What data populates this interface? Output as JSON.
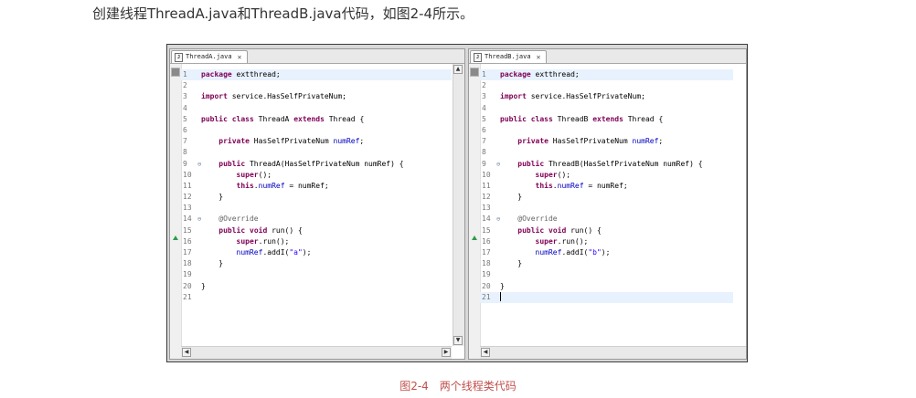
{
  "intro_text": "创建线程ThreadA.java和ThreadB.java代码，如图2-4所示。",
  "caption": "图2-4　两个线程类代码",
  "editors": [
    {
      "tab_label": "ThreadA.java",
      "lines": [
        {
          "n": "1",
          "code": [
            {
              "t": "package",
              "c": "kw"
            },
            {
              "t": " extthread;"
            }
          ]
        },
        {
          "n": "2",
          "code": []
        },
        {
          "n": "3",
          "code": [
            {
              "t": "import",
              "c": "kw"
            },
            {
              "t": " service.HasSelfPrivateNum;"
            }
          ]
        },
        {
          "n": "4",
          "code": []
        },
        {
          "n": "5",
          "code": [
            {
              "t": "public",
              "c": "kw"
            },
            {
              "t": " "
            },
            {
              "t": "class",
              "c": "kw"
            },
            {
              "t": " ThreadA "
            },
            {
              "t": "extends",
              "c": "kw"
            },
            {
              "t": " Thread {"
            }
          ]
        },
        {
          "n": "6",
          "code": []
        },
        {
          "n": "7",
          "code": [
            {
              "t": "    "
            },
            {
              "t": "private",
              "c": "kw"
            },
            {
              "t": " HasSelfPrivateNum "
            },
            {
              "t": "numRef",
              "c": "fld"
            },
            {
              "t": ";"
            }
          ]
        },
        {
          "n": "8",
          "code": []
        },
        {
          "n": "9",
          "fold": "⊖",
          "code": [
            {
              "t": "    "
            },
            {
              "t": "public",
              "c": "kw"
            },
            {
              "t": " ThreadA(HasSelfPrivateNum numRef) {"
            }
          ]
        },
        {
          "n": "10",
          "code": [
            {
              "t": "        "
            },
            {
              "t": "super",
              "c": "kw"
            },
            {
              "t": "();"
            }
          ]
        },
        {
          "n": "11",
          "code": [
            {
              "t": "        "
            },
            {
              "t": "this",
              "c": "kw"
            },
            {
              "t": "."
            },
            {
              "t": "numRef",
              "c": "fld"
            },
            {
              "t": " = numRef;"
            }
          ]
        },
        {
          "n": "12",
          "code": [
            {
              "t": "    }"
            }
          ]
        },
        {
          "n": "13",
          "code": []
        },
        {
          "n": "14",
          "fold": "⊖",
          "code": [
            {
              "t": "    "
            },
            {
              "t": "@Override",
              "c": "ann"
            }
          ]
        },
        {
          "n": "15",
          "code": [
            {
              "t": "    "
            },
            {
              "t": "public",
              "c": "kw"
            },
            {
              "t": " "
            },
            {
              "t": "void",
              "c": "kw"
            },
            {
              "t": " run() {"
            }
          ]
        },
        {
          "n": "16",
          "code": [
            {
              "t": "        "
            },
            {
              "t": "super",
              "c": "kw"
            },
            {
              "t": ".run();"
            }
          ]
        },
        {
          "n": "17",
          "code": [
            {
              "t": "        "
            },
            {
              "t": "numRef",
              "c": "fld"
            },
            {
              "t": ".addI("
            },
            {
              "t": "\"a\"",
              "c": "str"
            },
            {
              "t": ");"
            }
          ]
        },
        {
          "n": "18",
          "code": [
            {
              "t": "    }"
            }
          ]
        },
        {
          "n": "19",
          "code": []
        },
        {
          "n": "20",
          "code": [
            {
              "t": "}"
            }
          ]
        },
        {
          "n": "21",
          "code": []
        }
      ]
    },
    {
      "tab_label": "ThreadB.java",
      "lines": [
        {
          "n": "1",
          "code": [
            {
              "t": "package",
              "c": "kw"
            },
            {
              "t": " extthread;"
            }
          ]
        },
        {
          "n": "2",
          "code": []
        },
        {
          "n": "3",
          "code": [
            {
              "t": "import",
              "c": "kw"
            },
            {
              "t": " service.HasSelfPrivateNum;"
            }
          ]
        },
        {
          "n": "4",
          "code": []
        },
        {
          "n": "5",
          "code": [
            {
              "t": "public",
              "c": "kw"
            },
            {
              "t": " "
            },
            {
              "t": "class",
              "c": "kw"
            },
            {
              "t": " ThreadB "
            },
            {
              "t": "extends",
              "c": "kw"
            },
            {
              "t": " Thread {"
            }
          ]
        },
        {
          "n": "6",
          "code": []
        },
        {
          "n": "7",
          "code": [
            {
              "t": "    "
            },
            {
              "t": "private",
              "c": "kw"
            },
            {
              "t": " HasSelfPrivateNum "
            },
            {
              "t": "numRef",
              "c": "fld"
            },
            {
              "t": ";"
            }
          ]
        },
        {
          "n": "8",
          "code": []
        },
        {
          "n": "9",
          "fold": "⊖",
          "code": [
            {
              "t": "    "
            },
            {
              "t": "public",
              "c": "kw"
            },
            {
              "t": " ThreadB(HasSelfPrivateNum numRef) {"
            }
          ]
        },
        {
          "n": "10",
          "code": [
            {
              "t": "        "
            },
            {
              "t": "super",
              "c": "kw"
            },
            {
              "t": "();"
            }
          ]
        },
        {
          "n": "11",
          "code": [
            {
              "t": "        "
            },
            {
              "t": "this",
              "c": "kw"
            },
            {
              "t": "."
            },
            {
              "t": "numRef",
              "c": "fld"
            },
            {
              "t": " = numRef;"
            }
          ]
        },
        {
          "n": "12",
          "code": [
            {
              "t": "    }"
            }
          ]
        },
        {
          "n": "13",
          "code": []
        },
        {
          "n": "14",
          "fold": "⊖",
          "code": [
            {
              "t": "    "
            },
            {
              "t": "@Override",
              "c": "ann"
            }
          ]
        },
        {
          "n": "15",
          "code": [
            {
              "t": "    "
            },
            {
              "t": "public",
              "c": "kw"
            },
            {
              "t": " "
            },
            {
              "t": "void",
              "c": "kw"
            },
            {
              "t": " run() {"
            }
          ]
        },
        {
          "n": "16",
          "code": [
            {
              "t": "        "
            },
            {
              "t": "super",
              "c": "kw"
            },
            {
              "t": ".run();"
            }
          ]
        },
        {
          "n": "17",
          "code": [
            {
              "t": "        "
            },
            {
              "t": "numRef",
              "c": "fld"
            },
            {
              "t": ".addI("
            },
            {
              "t": "\"b\"",
              "c": "str"
            },
            {
              "t": ");"
            }
          ]
        },
        {
          "n": "18",
          "code": [
            {
              "t": "    }"
            }
          ]
        },
        {
          "n": "19",
          "code": []
        },
        {
          "n": "20",
          "code": [
            {
              "t": "}"
            }
          ]
        },
        {
          "n": "21",
          "code": [],
          "cursor": true
        }
      ]
    }
  ],
  "colors": {
    "keyword": "#7f0055",
    "field": "#0000c0",
    "string": "#2a00ff",
    "annotation": "#646464",
    "caption": "#c0504d"
  }
}
